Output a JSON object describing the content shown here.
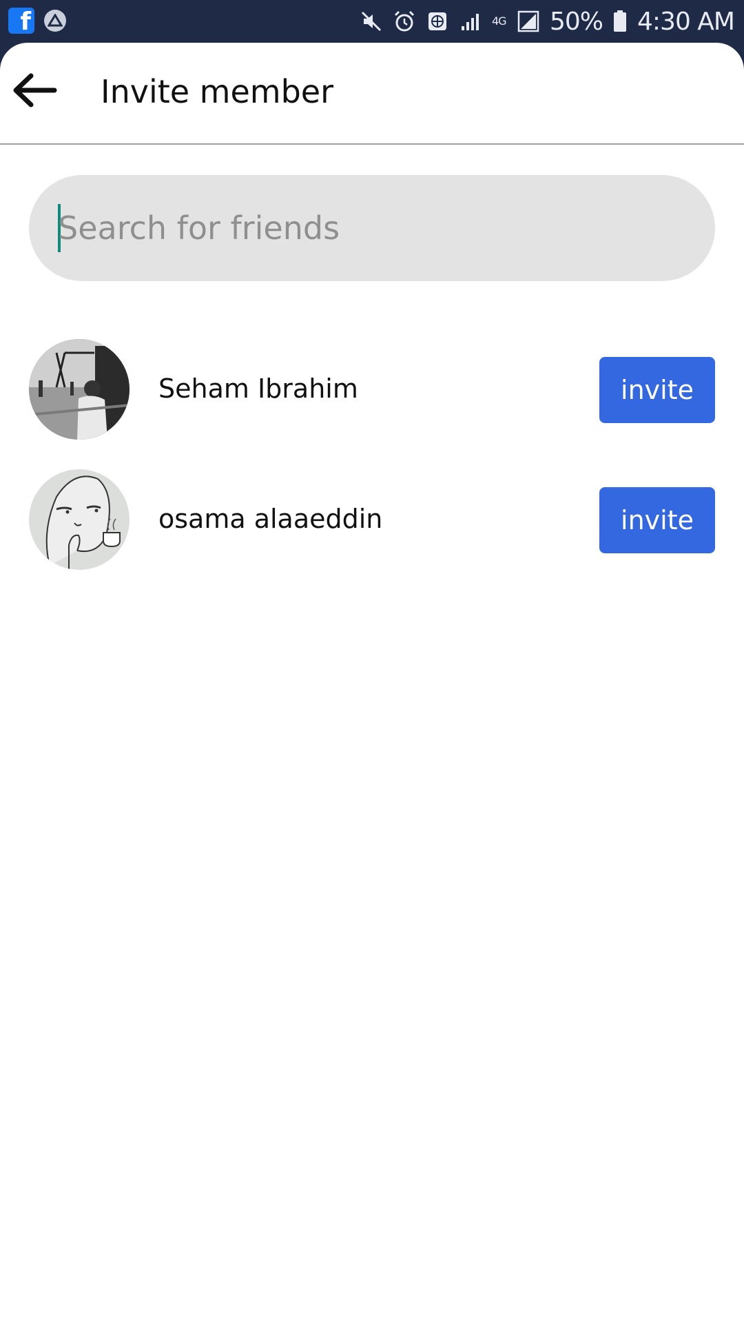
{
  "status_bar": {
    "battery": "50%",
    "time": "4:30 AM",
    "network": "4G",
    "icons": [
      "facebook-icon",
      "drive-icon",
      "mute-icon",
      "alarm-icon",
      "vpn-icon",
      "signal-icon",
      "network-4g-icon",
      "signal-full-icon",
      "battery-icon"
    ]
  },
  "header": {
    "title": "Invite member",
    "back_icon": "back-arrow-icon"
  },
  "search": {
    "placeholder": "Search for friends",
    "value": ""
  },
  "friends": [
    {
      "name": "Seham Ibrahim",
      "button": "invite"
    },
    {
      "name": "osama alaaeddin",
      "button": "invite"
    }
  ],
  "colors": {
    "status_bar_bg": "#1f2a47",
    "invite_button": "#3368e0",
    "search_bg": "#e3e3e3",
    "caret": "#0e8a7a"
  }
}
